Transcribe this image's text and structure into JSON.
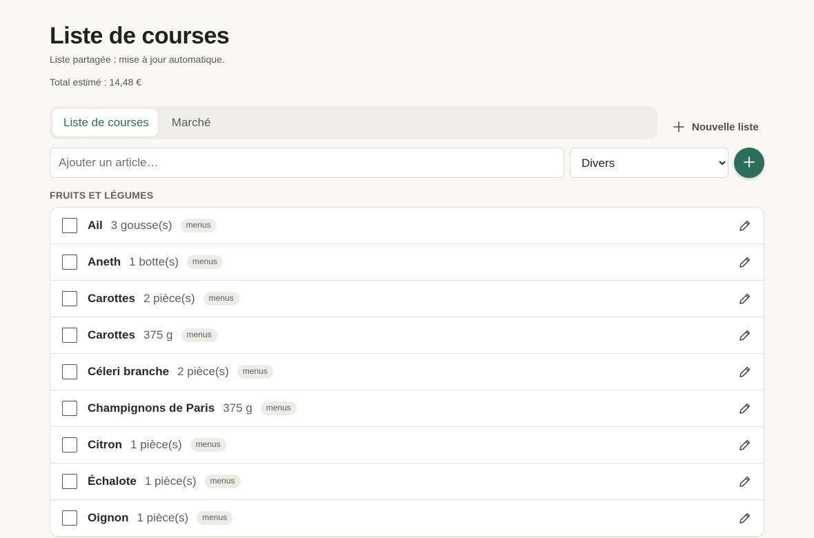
{
  "header": {
    "title": "Liste de courses",
    "subtitle": "Liste partagée : mise à jour automatique.",
    "total": "Total estimé : 14,48 €"
  },
  "tabs": [
    {
      "label": "Liste de courses",
      "active": true
    },
    {
      "label": "Marché",
      "active": false
    }
  ],
  "new_list": {
    "label": "Nouvelle liste",
    "icon": "plus-icon"
  },
  "add_form": {
    "placeholder": "Ajouter un article…",
    "value": "",
    "category_selected": "Divers",
    "add_icon": "plus-icon"
  },
  "colors": {
    "accent": "#2b6e5a",
    "background": "#f9f8f5",
    "badge_bg": "#eeece7"
  },
  "section": {
    "title": "FRUITS ET LÉGUMES",
    "items": [
      {
        "name": "Ail",
        "qty": "3 gousse(s)",
        "badge": "menus",
        "checked": false
      },
      {
        "name": "Aneth",
        "qty": "1 botte(s)",
        "badge": "menus",
        "checked": false
      },
      {
        "name": "Carottes",
        "qty": "2 pièce(s)",
        "badge": "menus",
        "checked": false
      },
      {
        "name": "Carottes",
        "qty": "375 g",
        "badge": "menus",
        "checked": false
      },
      {
        "name": "Céleri branche",
        "qty": "2 pièce(s)",
        "badge": "menus",
        "checked": false
      },
      {
        "name": "Champignons de Paris",
        "qty": "375 g",
        "badge": "menus",
        "checked": false
      },
      {
        "name": "Citron",
        "qty": "1 pièce(s)",
        "badge": "menus",
        "checked": false
      },
      {
        "name": "Échalote",
        "qty": "1 pièce(s)",
        "badge": "menus",
        "checked": false
      },
      {
        "name": "Oignon",
        "qty": "1 pièce(s)",
        "badge": "menus",
        "checked": false
      }
    ]
  }
}
